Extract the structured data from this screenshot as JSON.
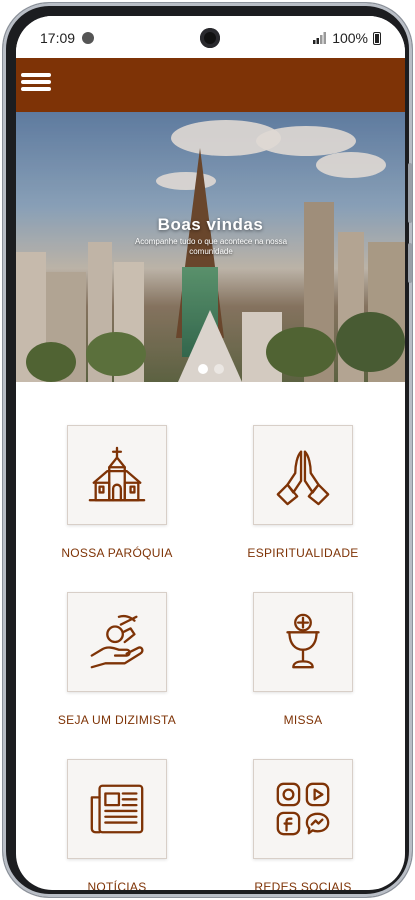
{
  "status_bar": {
    "time": "17:09",
    "battery": "100%"
  },
  "header": {
    "menu_icon": "hamburger-menu-icon",
    "background_color": "#7e3306"
  },
  "hero": {
    "title": "Boas vindas",
    "subtitle": "Acompanhe tudo o que acontece na nossa comunidade",
    "active_slide": 1,
    "slide_count": 2
  },
  "menu": {
    "items": [
      {
        "label": "NOSSA PARÓQUIA",
        "icon": "church-icon"
      },
      {
        "label": "ESPIRITUALIDADE",
        "icon": "praying-hands-icon"
      },
      {
        "label": "SEJA UM DIZIMISTA",
        "icon": "offering-hand-icon"
      },
      {
        "label": "MISSA",
        "icon": "chalice-icon"
      },
      {
        "label": "NOTÍCIAS",
        "icon": "newspaper-icon"
      },
      {
        "label": "REDES SOCIAIS",
        "icon": "social-media-icon"
      }
    ]
  },
  "colors": {
    "accent": "#7e3306",
    "tile_background": "#f7f5f3"
  }
}
